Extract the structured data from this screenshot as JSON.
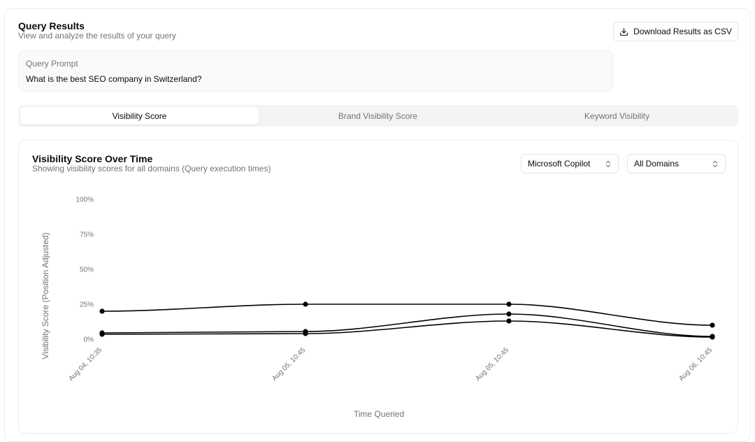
{
  "header": {
    "title": "Query Results",
    "subtitle": "View and analyze the results of your query",
    "download_label": "Download Results as CSV"
  },
  "prompt": {
    "label": "Query Prompt",
    "text": "What is the best SEO company in Switzerland?"
  },
  "tabs": [
    {
      "label": "Visibility Score",
      "active": true
    },
    {
      "label": "Brand Visibility Score",
      "active": false
    },
    {
      "label": "Keyword Visibility",
      "active": false
    }
  ],
  "chart_card": {
    "title": "Visibility Score Over Time",
    "subtitle": "Showing visibility scores for all domains (Query execution times)",
    "model_select": "Microsoft Copilot",
    "domain_select": "All Domains"
  },
  "icons": {
    "download": "download-icon",
    "select_chevron": "chevron-up-down-icon"
  },
  "colors": {
    "line": "#000000",
    "muted_text": "#737373",
    "border": "#e5e5e5"
  },
  "chart_data": {
    "type": "line",
    "x": [
      "Aug 04, 10:35",
      "Aug 05, 10:45",
      "Aug 05, 10:45",
      "Aug 06, 10:45"
    ],
    "xlabel": "Time Queried",
    "ylabel": "Visibility Score (Position Adjusted)",
    "ylim": [
      0,
      100
    ],
    "yticks": [
      "0%",
      "25%",
      "50%",
      "75%",
      "100%"
    ],
    "ytick_values": [
      0,
      25,
      50,
      75,
      100
    ],
    "grid": false,
    "series": [
      {
        "values": [
          20,
          25,
          25,
          10
        ]
      },
      {
        "values": [
          4.5,
          5.5,
          18,
          2
        ]
      },
      {
        "values": [
          3.5,
          4,
          13,
          1.5
        ]
      }
    ]
  }
}
